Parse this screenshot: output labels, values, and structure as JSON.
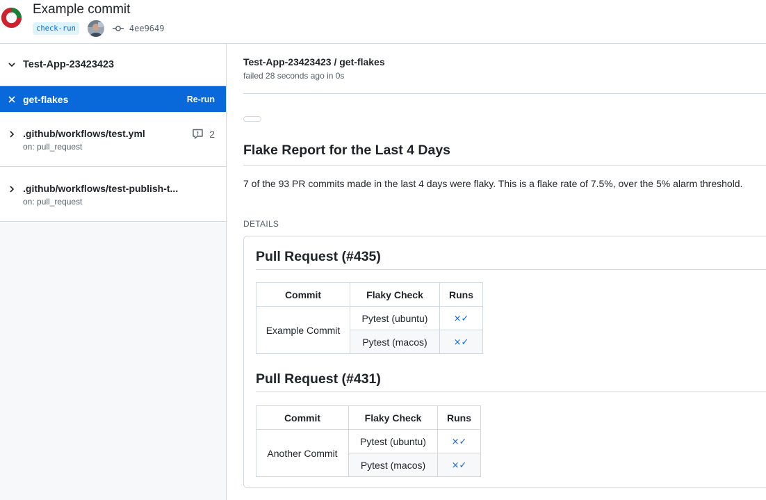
{
  "header": {
    "commit_title": "Example commit",
    "tag": "check-run",
    "sha": "4ee9649",
    "status_colors": {
      "failed": "#cf222e",
      "passed": "#1a7f37"
    }
  },
  "sidebar": {
    "app_name": "Test-App-23423423",
    "active_job": {
      "label": "get-flakes",
      "action": "Re-run"
    },
    "workflows": [
      {
        "title": ".github/workflows/test.yml",
        "trigger": "on: pull_request",
        "comments": "2"
      },
      {
        "title": ".github/workflows/test-publish-t...",
        "trigger": "on: pull_request"
      }
    ]
  },
  "main": {
    "run_title": "Test-App-23423423 / get-flakes",
    "run_status": "failed 28 seconds ago in 0s",
    "report_title": "Flake Report for the Last 4 Days",
    "report_text": "7 of the 93 PR commits made in the last 4 days were flaky. This is a flake rate of 7.5%, over the 5% alarm threshold.",
    "details_label": "DETAILS",
    "table_headers": [
      "Commit",
      "Flaky Check",
      "Runs"
    ],
    "pull_requests": [
      {
        "title": "Pull Request (#435)",
        "commit": "Example Commit",
        "checks": [
          {
            "name": "Pytest (ubuntu)",
            "runs": "×✓"
          },
          {
            "name": "Pytest (macos)",
            "runs": "×✓"
          }
        ]
      },
      {
        "title": "Pull Request (#431)",
        "commit": "Another Commit",
        "checks": [
          {
            "name": "Pytest (ubuntu)",
            "runs": "×✓"
          },
          {
            "name": "Pytest (macos)",
            "runs": "×✓"
          }
        ]
      }
    ]
  }
}
